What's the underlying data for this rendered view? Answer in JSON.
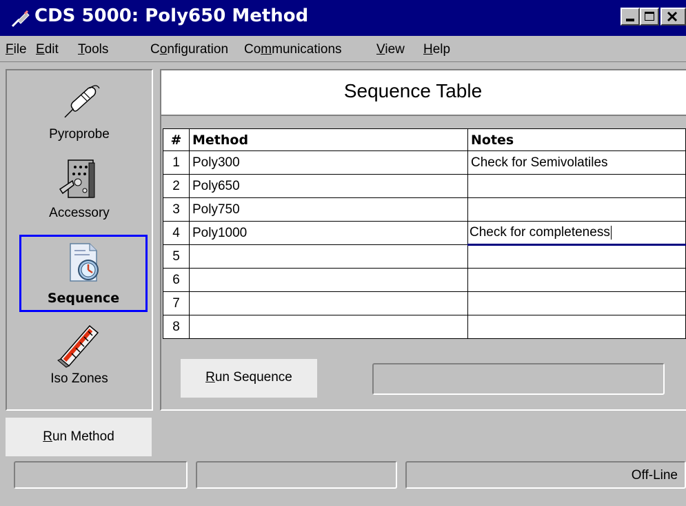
{
  "window": {
    "title": "CDS 5000: Poly650 Method",
    "icon": "pyroprobe-icon"
  },
  "menu": [
    {
      "pre": "",
      "key": "F",
      "post": "ile"
    },
    {
      "pre": "",
      "key": "E",
      "post": "dit"
    },
    {
      "pre": "",
      "key": "T",
      "post": "ools"
    },
    {
      "pre": "C",
      "key": "o",
      "post": "nfiguration"
    },
    {
      "pre": "Co",
      "key": "m",
      "post": "munications"
    },
    {
      "pre": "",
      "key": "V",
      "post": "iew"
    },
    {
      "pre": "",
      "key": "H",
      "post": "elp"
    }
  ],
  "sidebar": {
    "items": [
      {
        "label": "Pyroprobe",
        "icon": "pyroprobe-icon"
      },
      {
        "label": "Accessory",
        "icon": "accessory-icon"
      },
      {
        "label": "Sequence",
        "icon": "sequence-icon",
        "selected": true
      },
      {
        "label": "Iso Zones",
        "icon": "iso-zones-icon"
      }
    ],
    "run_method_key": "R",
    "run_method_rest": "un Method"
  },
  "main": {
    "title": "Sequence Table",
    "columns": [
      "#",
      "Method",
      "Notes"
    ],
    "rows": [
      {
        "num": "1",
        "method": "Poly300",
        "notes": "Check for Semivolatiles"
      },
      {
        "num": "2",
        "method": "Poly650",
        "notes": ""
      },
      {
        "num": "3",
        "method": "Poly750",
        "notes": ""
      },
      {
        "num": "4",
        "method": "Poly1000",
        "notes": "Check for completeness"
      },
      {
        "num": "5",
        "method": "",
        "notes": ""
      },
      {
        "num": "6",
        "method": "",
        "notes": ""
      },
      {
        "num": "7",
        "method": "",
        "notes": ""
      },
      {
        "num": "8",
        "method": "",
        "notes": ""
      }
    ],
    "run_sequence_key": "R",
    "run_sequence_rest": "un Sequence",
    "progress_text": ""
  },
  "statusbar": {
    "field1": "",
    "field2": "",
    "field3": "Off-Line"
  },
  "colors": {
    "titlebar": "#000080",
    "window": "#c0c0c0",
    "selection_border": "#0000ff"
  }
}
